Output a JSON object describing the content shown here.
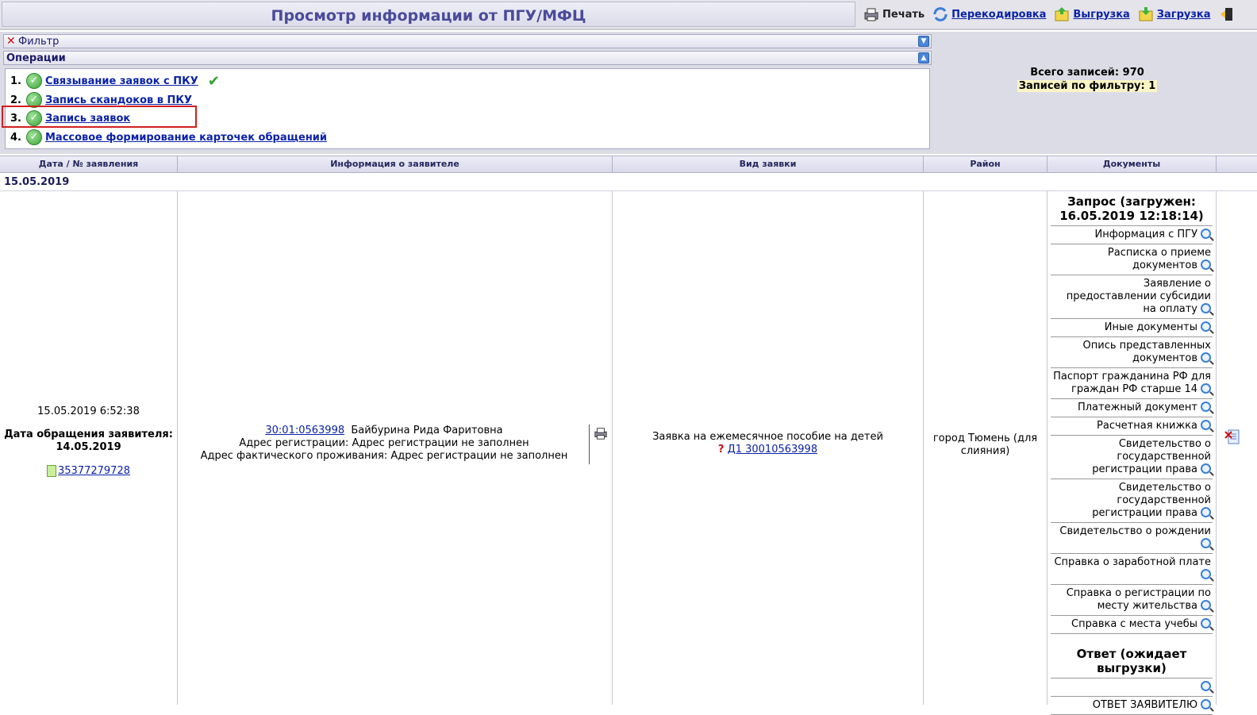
{
  "header": {
    "title": "Просмотр информации от ПГУ/МФЦ",
    "print_label": "Печать",
    "recode_label": "Перекодировка",
    "export_label": "Выгрузка",
    "import_label": "Загрузка"
  },
  "filter": {
    "label": "Фильтр"
  },
  "operations": {
    "label": "Операции",
    "items": [
      {
        "num": "1.",
        "label": "Связывание заявок с ПКУ"
      },
      {
        "num": "2.",
        "label": "Запись скандоков в ПКУ"
      },
      {
        "num": "3.",
        "label": "Запись заявок"
      },
      {
        "num": "4.",
        "label": "Массовое формирование карточек обращений"
      }
    ]
  },
  "stats": {
    "total_label": "Всего записей:",
    "total_value": "970",
    "filtered_label": "Записей по фильтру:",
    "filtered_value": "1"
  },
  "table": {
    "columns": [
      "Дата / № заявления",
      "Информация о заявителе",
      "Вид заявки",
      "Район",
      "Документы"
    ],
    "group_date": "15.05.2019",
    "row": {
      "datetime": "15.05.2019 6:52:38",
      "appeal_label": "Дата обращения заявителя:",
      "appeal_date": "14.05.2019",
      "app_number": "35377279728",
      "applicant_code": "30:01:0563998",
      "applicant_name": "Байбурина Рида Фаритовна",
      "reg_address": "Адрес регистрации: Адрес регистрации не заполнен",
      "fact_address": "Адрес фактического проживания: Адрес регистрации не заполнен",
      "request_type": "Заявка на ежемесячное пособие на детей",
      "request_q": "?",
      "request_link": " Д1  30010563998",
      "district": "город Тюмень (для слияния)",
      "request_section": "Запрос (загружен: 16.05.2019 12:18:14)",
      "documents": [
        "Информация с ПГУ",
        "Расписка о приеме документов",
        "Заявление о предоставлении субсидии на оплату",
        "Иные документы",
        "Опись представленных документов",
        "Паспорт гражданина РФ для граждан РФ старше 14",
        "Платежный документ",
        "Расчетная книжка",
        "Свидетельство о государственной регистрации права",
        "Свидетельство о государственной регистрации права",
        "Свидетельство о рождении",
        "Справка о заработной плате",
        "Справка о регистрации по месту жительства",
        "Справка с места учебы"
      ],
      "answer_section": "Ответ (ожидает выгрузки)",
      "answer_docs": [
        "",
        "ОТВЕТ ЗАЯВИТЕЛЮ"
      ]
    }
  }
}
